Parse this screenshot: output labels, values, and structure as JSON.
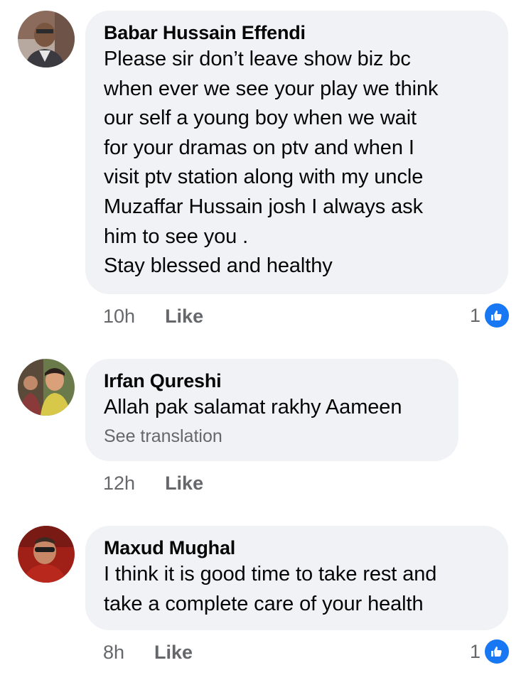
{
  "comments": [
    {
      "author": "Babar Hussain Effendi",
      "text": "Please sir don’t leave show biz bc\nwhen ever we see your play we think\nour self a young boy when we wait\nfor your dramas on ptv and when I\nvisit ptv station along with my uncle\nMuzaffar Hussain josh I always ask\nhim to see you .\nStay blessed and healthy",
      "time": "10h",
      "like_label": "Like",
      "reaction_count": "1",
      "reaction_icon": "thumbs-up-icon"
    },
    {
      "author": "Irfan Qureshi",
      "text": "Allah pak salamat rakhy Aameen",
      "see_translation": "See translation",
      "time": "12h",
      "like_label": "Like"
    },
    {
      "author": "Maxud Mughal",
      "text": "I think it is good time to take rest and\ntake a complete care of your health",
      "time": "8h",
      "like_label": "Like",
      "reaction_count": "1",
      "reaction_icon": "thumbs-up-icon"
    }
  ],
  "colors": {
    "bubble_bg": "#f0f2f5",
    "meta_text": "#65676b",
    "like_badge": "#1877f2"
  }
}
